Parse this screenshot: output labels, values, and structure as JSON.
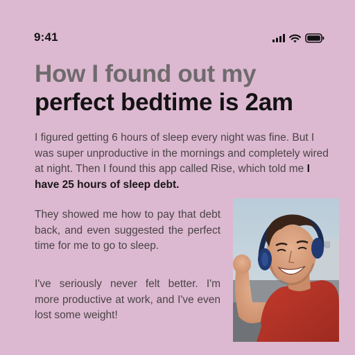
{
  "status_bar": {
    "time": "9:41",
    "icons": [
      "cellular-signal-icon",
      "wifi-icon",
      "battery-icon"
    ]
  },
  "headline": {
    "line1": "How I found out my",
    "line2": "perfect bedtime is 2am"
  },
  "body": {
    "intro_text": "I figured getting 6 hours of sleep every night was fine. But I was super unproductive in the mornings and completely wired at night. Then I found this app called Rise, which told me ",
    "intro_bold": "I have 25 hours of sleep debt.",
    "paragraph2": "They showed me how to pay that debt back, and even suggested the perfect time for me to go to sleep.",
    "paragraph3": "I've seriously never felt better. I'm more productive at work, and I've even lost some weight!"
  },
  "colors": {
    "background": "#dcb9d1",
    "headline_muted": "#6f6a6c",
    "headline_dark": "#141213",
    "body_text": "#4a4346"
  }
}
